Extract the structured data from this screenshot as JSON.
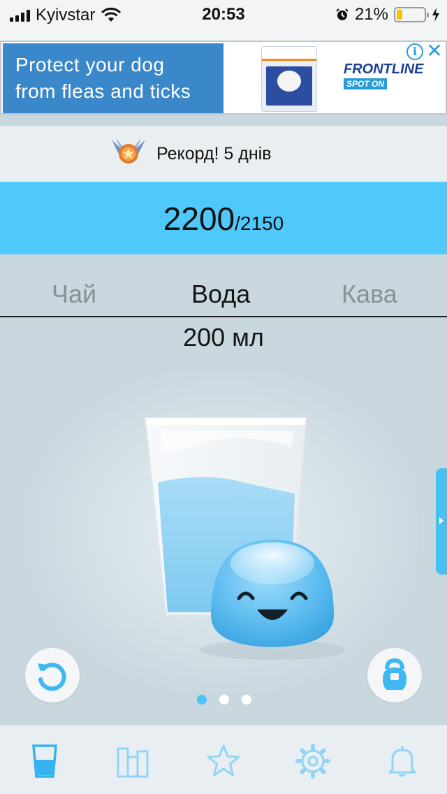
{
  "status_bar": {
    "carrier": "Kyivstar",
    "time": "20:53",
    "battery_percent": "21%",
    "battery_level": 0.21
  },
  "ad": {
    "headline_line1": "Protect your dog",
    "headline_line2": "from fleas and ticks",
    "brand": "FRONTLINE",
    "brand_sub": "SPOT ON",
    "info_icon": "info-icon",
    "close_icon": "close-icon"
  },
  "record": {
    "text": "Рекорд! 5 днів",
    "icon": "medal-icon"
  },
  "progress": {
    "current": "2200",
    "goal": "/2150"
  },
  "drink_tabs": {
    "items": [
      {
        "label": "Чай",
        "selected": false
      },
      {
        "label": "Вода",
        "selected": true
      },
      {
        "label": "Кава",
        "selected": false
      }
    ],
    "volume": "200 мл"
  },
  "illustration": {
    "glass_fill_level": 0.55,
    "icon": "water-glass-with-smiling-drop"
  },
  "actions": {
    "undo_icon": "undo-icon",
    "weight_icon": "kettlebell-icon"
  },
  "pager": {
    "pages": 3,
    "active_index": 0
  },
  "bottom_nav": {
    "items": [
      {
        "icon": "glass-icon",
        "active": true
      },
      {
        "icon": "stats-icon",
        "active": false
      },
      {
        "icon": "star-icon",
        "active": false
      },
      {
        "icon": "gear-icon",
        "active": false
      },
      {
        "icon": "bell-icon",
        "active": false
      }
    ]
  },
  "colors": {
    "accent": "#4fc8fb",
    "background": "#c9d7de",
    "nav_icon": "#6dcbf5"
  }
}
